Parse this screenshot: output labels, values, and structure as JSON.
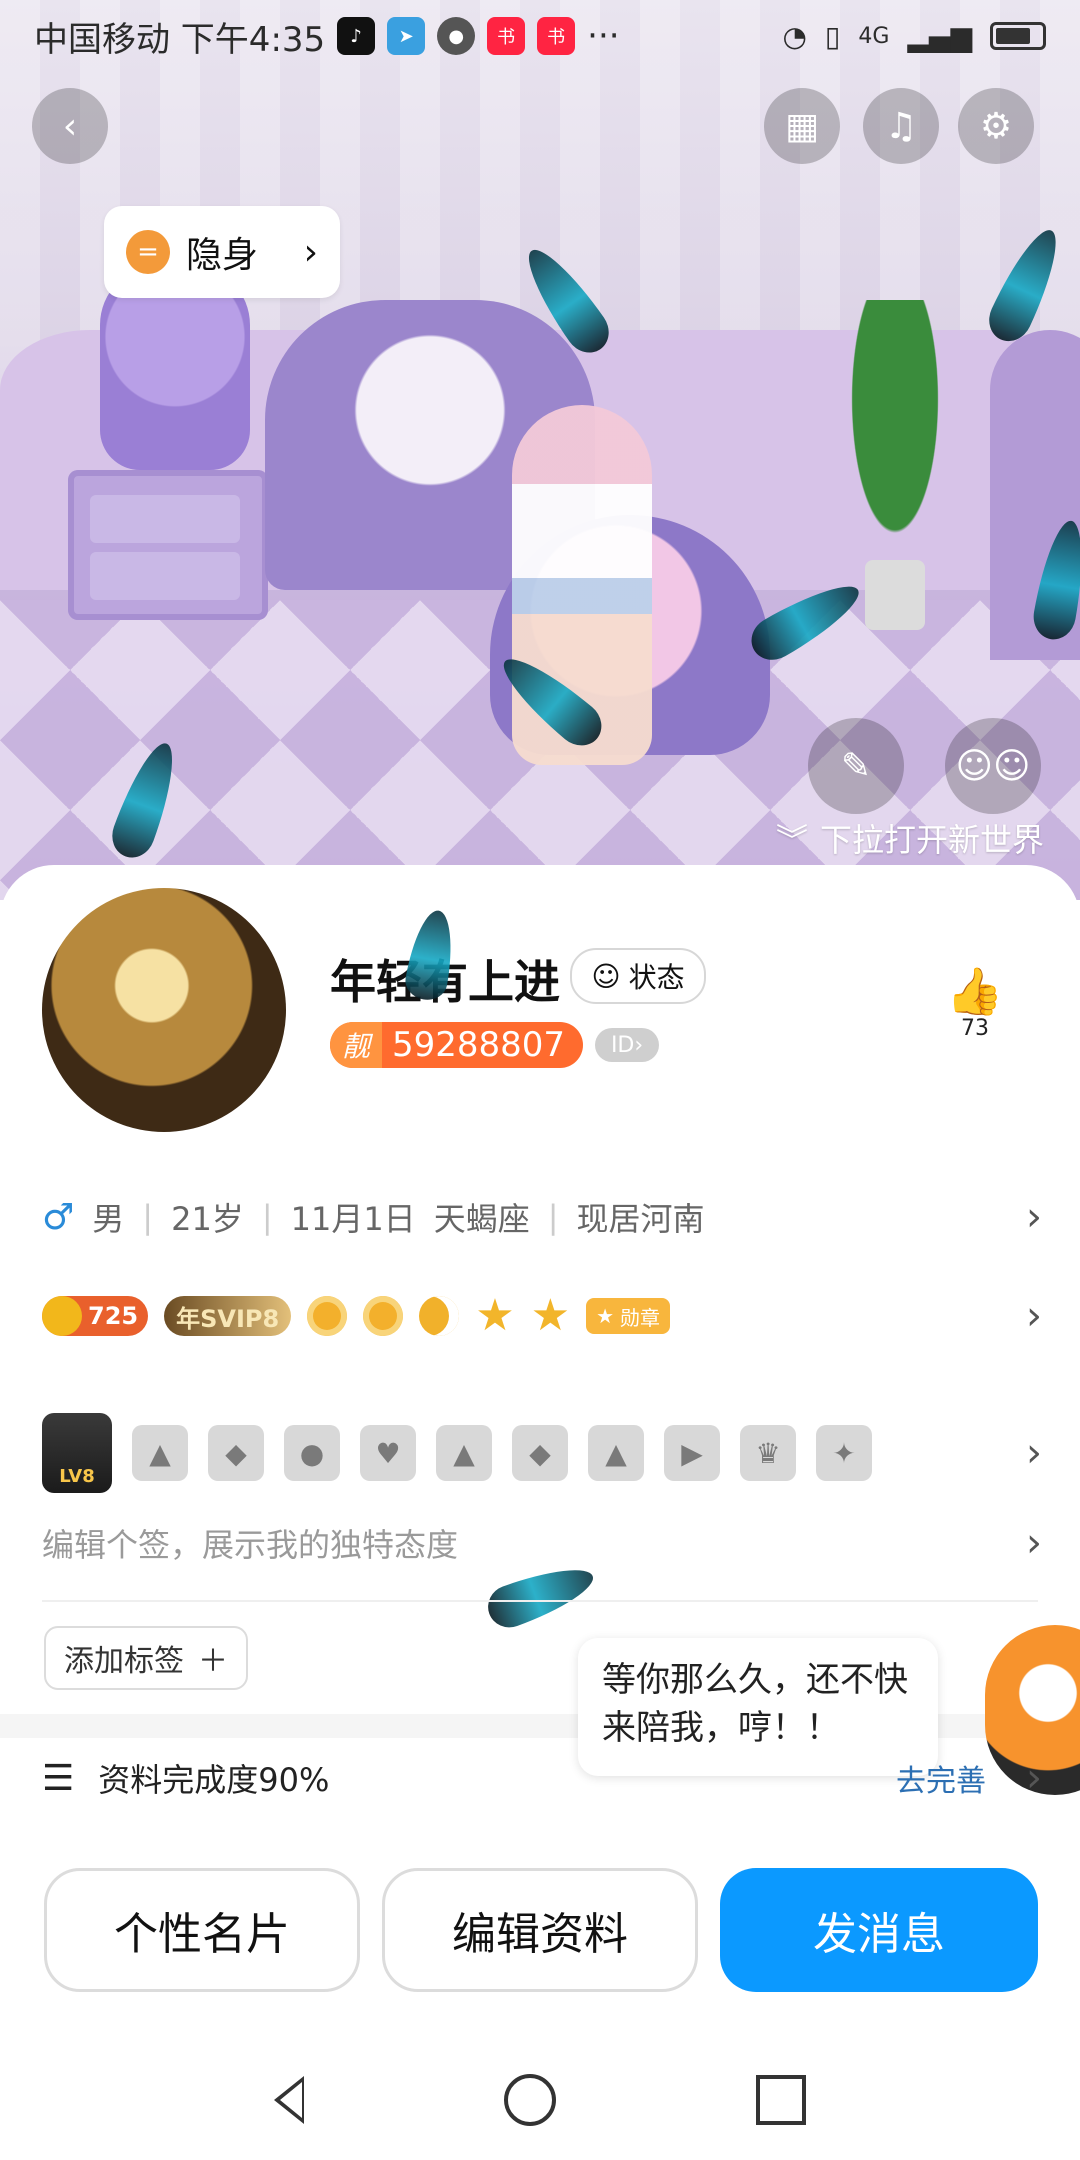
{
  "status_bar": {
    "carrier_time": "中国移动 下午4:35",
    "more": "···",
    "signal_label": "4G",
    "mini_icons": [
      "tiktok-icon",
      "telegram-icon",
      "chrome-icon",
      "xiaohongshu-icon",
      "xiaohongshu-icon"
    ]
  },
  "hero": {
    "stealth_label": "隐身",
    "pull_hint": "下拉打开新世界"
  },
  "profile": {
    "username": "年轻有上进",
    "status_chip": "状态",
    "pretty_label": "靓",
    "pretty_id": "59288807",
    "id_tag": "ID",
    "likes_count": "73",
    "gender_symbol": "♂",
    "gender": "男",
    "age": "21岁",
    "birthday": "11月1日",
    "zodiac": "天蝎座",
    "location": "现居河南",
    "coin_value": "725",
    "svip": "年SVIP8",
    "medal": "勋章",
    "level_label": "LV8",
    "signature_placeholder": "编辑个签，展示我的独特态度",
    "add_tag_label": "添加标签",
    "add_tag_plus": "＋",
    "bubble_text": "等你那么久，还不快来陪我，哼！！",
    "completion": "资料完成度90%",
    "completion_link": "去完善"
  },
  "actions": {
    "card": "个性名片",
    "edit": "编辑资料",
    "message": "发消息"
  },
  "colors": {
    "primary": "#0b99ff",
    "pretty_badge": "#ff6b2e",
    "link": "#2c6fb3"
  }
}
